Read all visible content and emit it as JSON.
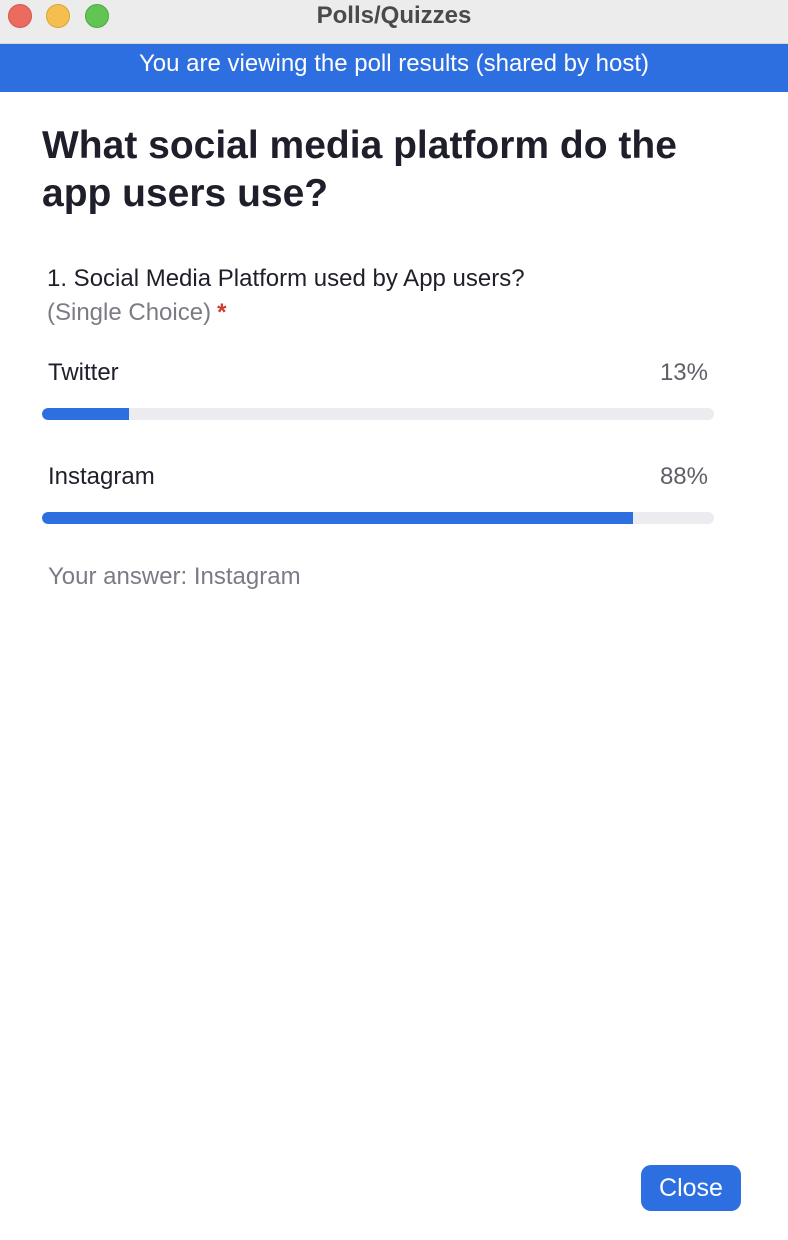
{
  "window": {
    "title": "Polls/Quizzes"
  },
  "banner": {
    "text": "You are viewing the poll results (shared by host)"
  },
  "poll": {
    "title": "What social media platform do the app users use?",
    "question": "1. Social Media Platform used by App users?",
    "question_type": "(Single Choice)",
    "required_marker": "*",
    "options": [
      {
        "label": "Twitter",
        "percent_text": "13%",
        "percent": 13
      },
      {
        "label": "Instagram",
        "percent_text": "88%",
        "percent": 88
      }
    ],
    "your_answer": "Your answer: Instagram"
  },
  "footer": {
    "close_label": "Close"
  },
  "colors": {
    "accent": "#2d6fe0",
    "track": "#ececf0",
    "required": "#d23b30"
  }
}
